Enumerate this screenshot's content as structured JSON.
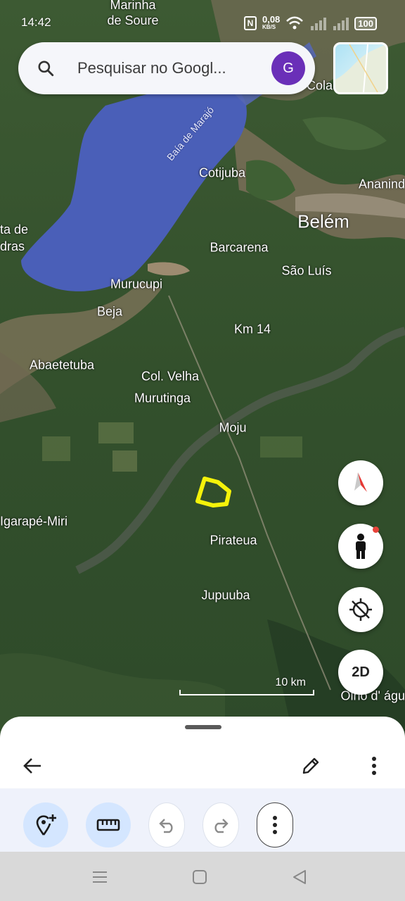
{
  "status_bar": {
    "time": "14:42",
    "net_speed": "0,08",
    "net_unit": "KB/S",
    "battery": "100"
  },
  "search": {
    "placeholder": "Pesquisar no Googl...",
    "avatar_letter": "G"
  },
  "map": {
    "places": {
      "marinha_de_soure": "Marinha\nde Soure",
      "colares": "Colar",
      "baia_de_marajo": "Baía de Marajó",
      "cotijuba": "Cotijuba",
      "ananindeua": "Ananind",
      "belem": "Belém",
      "ponta_de_pedras": "ta de\ndras",
      "barcarena": "Barcarena",
      "sao_luis": "São Luís",
      "murucupi": "Murucupi",
      "beja": "Beja",
      "km14": "Km 14",
      "abaetetuba": "Abaetetuba",
      "col_velha": "Col. Velha",
      "murutinga": "Murutinga",
      "moju": "Moju",
      "igarape_miri": "Igarapé-Miri",
      "pirateua": "Pirateua",
      "jupuuba": "Jupuuba",
      "olho_dagua": "Olho d' águ"
    },
    "scale_label": "10 km",
    "toggle_2d": "2D",
    "colors": {
      "water": "#4a5fb8",
      "shape_outline": "#f5f20a"
    }
  },
  "sheet": {
    "icons": {
      "back": "arrow-back-icon",
      "edit": "pencil-icon",
      "more": "more-vert-icon",
      "add_placemark": "add-location-icon",
      "measure": "ruler-icon",
      "undo": "undo-icon",
      "redo": "redo-icon"
    }
  },
  "nav": {
    "icons": [
      "menu-icon",
      "home-square-icon",
      "back-triangle-icon"
    ]
  }
}
